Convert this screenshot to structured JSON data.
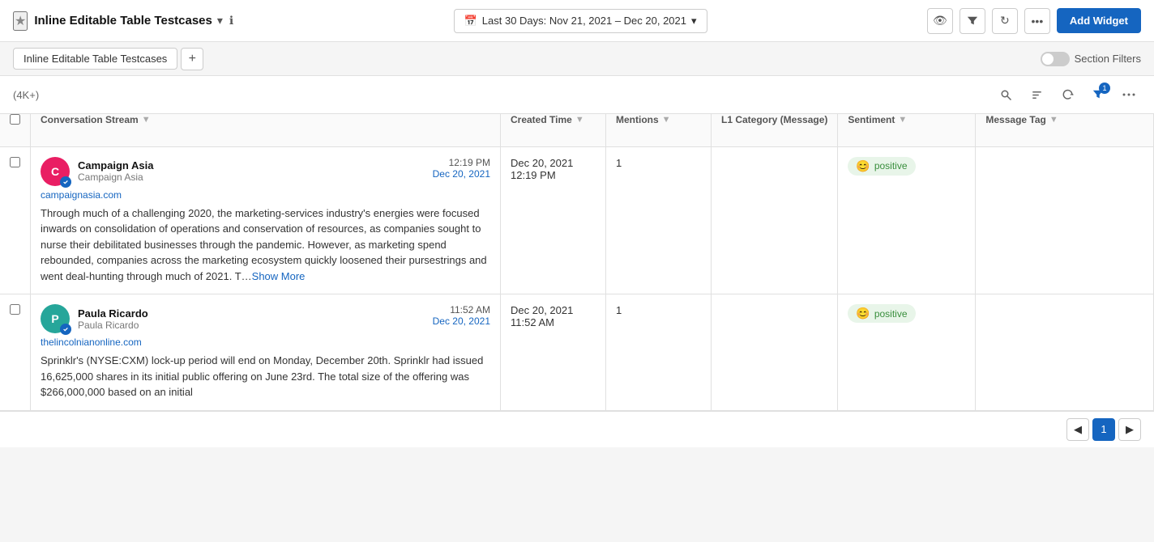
{
  "header": {
    "star_label": "★",
    "title": "Inline Editable Table Testcases",
    "chevron": "▾",
    "info": "ℹ",
    "date_range": "Last 30 Days: Nov 21, 2021 – Dec 20, 2021",
    "eye_icon": "👁",
    "filter_icon": "⚗",
    "refresh_icon": "↻",
    "more_icon": "•••",
    "add_widget_label": "Add Widget"
  },
  "tabs": {
    "active_tab": "Inline Editable Table Testcases",
    "add_icon": "+",
    "section_filters_label": "Section Filters"
  },
  "toolbar": {
    "row_count": "(4K+)",
    "search_icon": "🔍",
    "sort_icon": "⇅",
    "refresh_icon": "↻",
    "filter_icon": "⚗",
    "filter_badge": "1",
    "more_icon": "•••"
  },
  "table": {
    "columns": [
      {
        "id": "conversation",
        "label": "Conversation Stream",
        "sortable": true
      },
      {
        "id": "created",
        "label": "Created Time",
        "sortable": true
      },
      {
        "id": "mentions",
        "label": "Mentions",
        "sortable": true
      },
      {
        "id": "l1category",
        "label": "L1 Category (Message)",
        "sortable": false
      },
      {
        "id": "sentiment",
        "label": "Sentiment",
        "sortable": true
      },
      {
        "id": "messagetag",
        "label": "Message Tag",
        "sortable": true
      }
    ],
    "rows": [
      {
        "id": "row1",
        "author": "Campaign Asia",
        "source": "Campaign Asia",
        "source_url": "campaignasia.com",
        "avatar_color": "#e91e63",
        "avatar_letter": "C",
        "time_main": "12:19 PM",
        "time_date": "Dec 20, 2021",
        "created_datetime": "Dec 20, 2021 12:19 PM",
        "mentions": "1",
        "l1category": "",
        "sentiment": "positive",
        "message_tag": "",
        "content": "Through much of a challenging 2020, the marketing-services industry's energies were focused inwards on consolidation of operations and conservation of resources, as companies sought to nurse their debilitated businesses through the pandemic. However, as marketing spend rebounded, companies across the marketing ecosystem quickly loosened their pursestrings and went deal-hunting through much of 2021.  T…",
        "show_more": "Show More"
      },
      {
        "id": "row2",
        "author": "Paula Ricardo",
        "source": "Paula Ricardo",
        "source_url": "thelincolnianonline.com",
        "avatar_color": "#26a69a",
        "avatar_letter": "P",
        "time_main": "11:52 AM",
        "time_date": "Dec 20, 2021",
        "created_datetime": "Dec 20, 2021 11:52 AM",
        "mentions": "1",
        "l1category": "",
        "sentiment": "positive",
        "message_tag": "",
        "content": "Sprinklr's (NYSE:CXM) lock-up period will end on Monday, December 20th. Sprinklr had issued 16,625,000 shares in its initial public offering on June 23rd. The total size of the offering was $266,000,000 based on an initial",
        "show_more": ""
      }
    ]
  },
  "pagination": {
    "prev_icon": "◀",
    "current_page": "1",
    "next_icon": "▶"
  }
}
